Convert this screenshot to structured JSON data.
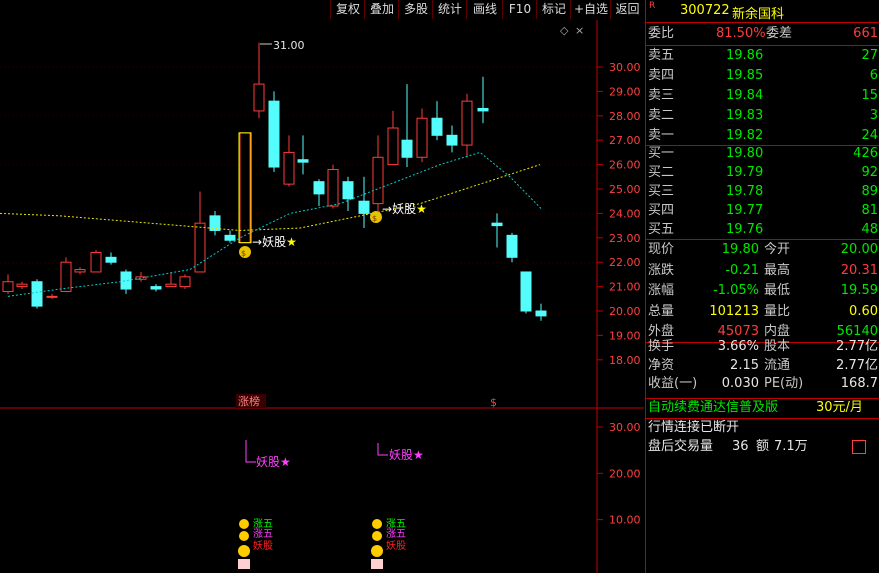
{
  "toolbar": {
    "buttons": [
      "复权",
      "叠加",
      "多股",
      "统计",
      "画线",
      "F10",
      "标记",
      "+自选",
      "返回"
    ]
  },
  "chart": {
    "peak_label": "31.00",
    "price_ticks": [
      "30.00",
      "29.00",
      "28.00",
      "27.00",
      "26.00",
      "25.00",
      "24.00",
      "23.00",
      "22.00",
      "21.00",
      "20.00",
      "19.00",
      "18.00"
    ],
    "lower_ticks": [
      "30.00",
      "20.00",
      "10.00"
    ],
    "signal_label": "妖股",
    "star": "★",
    "bottom_label": "涨榜",
    "bottom_marker": "$",
    "diamond": "◇",
    "stack_labels": [
      "涨五",
      "涨五",
      "妖股"
    ],
    "colors": {
      "up": "#ff3c3c",
      "down": "#54fcfc",
      "ma_fast": "#00cccc",
      "ma_slow": "#e6e600",
      "axis": "#c00000",
      "label": "#ff40ff"
    }
  },
  "quote": {
    "badge": "R",
    "code": "300722",
    "name": "新余国科",
    "weibi_label": "委比",
    "weibi_value": "81.50%",
    "weicha_label": "委差",
    "weicha_value": "661",
    "sell": [
      {
        "label": "卖五",
        "price": "19.86",
        "vol": "27"
      },
      {
        "label": "卖四",
        "price": "19.85",
        "vol": "6"
      },
      {
        "label": "卖三",
        "price": "19.84",
        "vol": "15"
      },
      {
        "label": "卖二",
        "price": "19.83",
        "vol": "3"
      },
      {
        "label": "卖一",
        "price": "19.82",
        "vol": "24"
      }
    ],
    "buy": [
      {
        "label": "买一",
        "price": "19.80",
        "vol": "426"
      },
      {
        "label": "买二",
        "price": "19.79",
        "vol": "92"
      },
      {
        "label": "买三",
        "price": "19.78",
        "vol": "89"
      },
      {
        "label": "买四",
        "price": "19.77",
        "vol": "81"
      },
      {
        "label": "买五",
        "price": "19.76",
        "vol": "48"
      }
    ],
    "stats": [
      {
        "l1": "现价",
        "v1": "19.80",
        "c1": "grn",
        "l2": "今开",
        "v2": "20.00",
        "c2": "grn"
      },
      {
        "l1": "涨跌",
        "v1": "-0.21",
        "c1": "grn",
        "l2": "最高",
        "v2": "20.31",
        "c2": "red"
      },
      {
        "l1": "涨幅",
        "v1": "-1.05%",
        "c1": "grn",
        "l2": "最低",
        "v2": "19.59",
        "c2": "grn"
      },
      {
        "l1": "总量",
        "v1": "101213",
        "c1": "yel",
        "l2": "量比",
        "v2": "0.60",
        "c2": "yel"
      },
      {
        "l1": "外盘",
        "v1": "45073",
        "c1": "red",
        "l2": "内盘",
        "v2": "56140",
        "c2": "grn"
      }
    ],
    "fin": [
      {
        "l1": "换手",
        "v1": "3.66%",
        "l2": "股本",
        "v2": "2.77亿"
      },
      {
        "l1": "净资",
        "v1": "2.15",
        "l2": "流通",
        "v2": "2.77亿"
      },
      {
        "l1": "收益(一)",
        "v1": "0.030",
        "l2": "PE(动)",
        "v2": "168.7"
      }
    ],
    "promo_text": "自动续费通达信普及版",
    "promo_price": "30元/月",
    "status": "行情连接已断开",
    "after_hours_label": "盘后交易量",
    "after_hours_vol": "36",
    "after_hours_amt_label": "额",
    "after_hours_amt": "7.1万"
  }
}
